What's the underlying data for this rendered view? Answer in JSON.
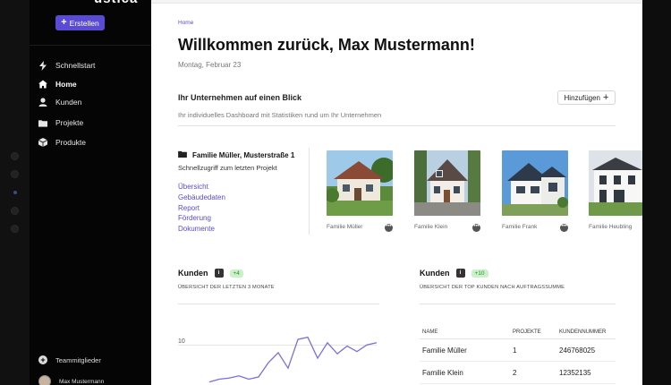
{
  "sidebar": {
    "logo": "ustica",
    "create_label": "Erstellen",
    "items": [
      {
        "label": "Schnellstart",
        "icon": "bolt-icon"
      },
      {
        "label": "Home",
        "icon": "home-icon"
      },
      {
        "label": "Kunden",
        "icon": "user-icon"
      },
      {
        "label": "Projekte",
        "icon": "folder-icon"
      },
      {
        "label": "Produkte",
        "icon": "box-icon"
      }
    ],
    "team_label": "Teammitglieder",
    "user_name": "Max Mustermann"
  },
  "main": {
    "breadcrumb": "Home",
    "title": "Willkommen zurück, Max Mustermann!",
    "date": "Montag, Februar 23",
    "overview": {
      "title": "Ihr Unternehmen auf einen Blick",
      "add_label": "Hinzufügen",
      "subtitle": "Ihr individuelles Dashboard mit Statistiken rund um Ihr Unternehmen"
    },
    "last_project": {
      "title": "Familie Müller, Musterstraße 1",
      "subtitle": "Schnellzugriff zum letzten Projekt",
      "links": [
        "Übersicht",
        "Gebäudedaten",
        "Report",
        "Förderung",
        "Dokumente"
      ]
    },
    "projects": [
      {
        "label": "Familie Müller"
      },
      {
        "label": "Familie Klein"
      },
      {
        "label": "Familie Frank"
      },
      {
        "label": "Familie Heubling"
      }
    ],
    "customers_chart_card": {
      "title": "Kunden",
      "badge": "+4",
      "subtitle": "ÜBERSICHT DER LETZTEN 3 MONATE",
      "y_tick": "10"
    },
    "customers_table_card": {
      "title": "Kunden",
      "badge": "+10",
      "subtitle": "ÜBERSICHT DER TOP KUNDEN NACH AUFTRAGSSUMME",
      "columns": [
        "NAME",
        "PROJEKTE",
        "KUNDENNUMMER"
      ],
      "rows": [
        [
          "Familie Müller",
          "1",
          "246768025"
        ],
        [
          "Familie Klein",
          "2",
          "12352135"
        ]
      ]
    }
  },
  "colors": {
    "accent": "#5a4bd6",
    "badge_bg": "#c9f2c9",
    "badge_text": "#2c8a2c",
    "chart_line": "#7a6de0"
  },
  "chart_data": {
    "type": "line",
    "y_tick_labels": [
      "10"
    ],
    "series": [
      {
        "values": [
          2.5,
          3.0,
          3.2,
          3.6,
          3.0,
          3.4,
          6.0,
          7.8,
          5.0,
          10.2,
          10.6,
          6.8,
          9.6,
          7.6,
          9.0,
          8.0,
          9.2,
          9.6
        ]
      }
    ],
    "ylim": [
      0,
      12
    ]
  }
}
